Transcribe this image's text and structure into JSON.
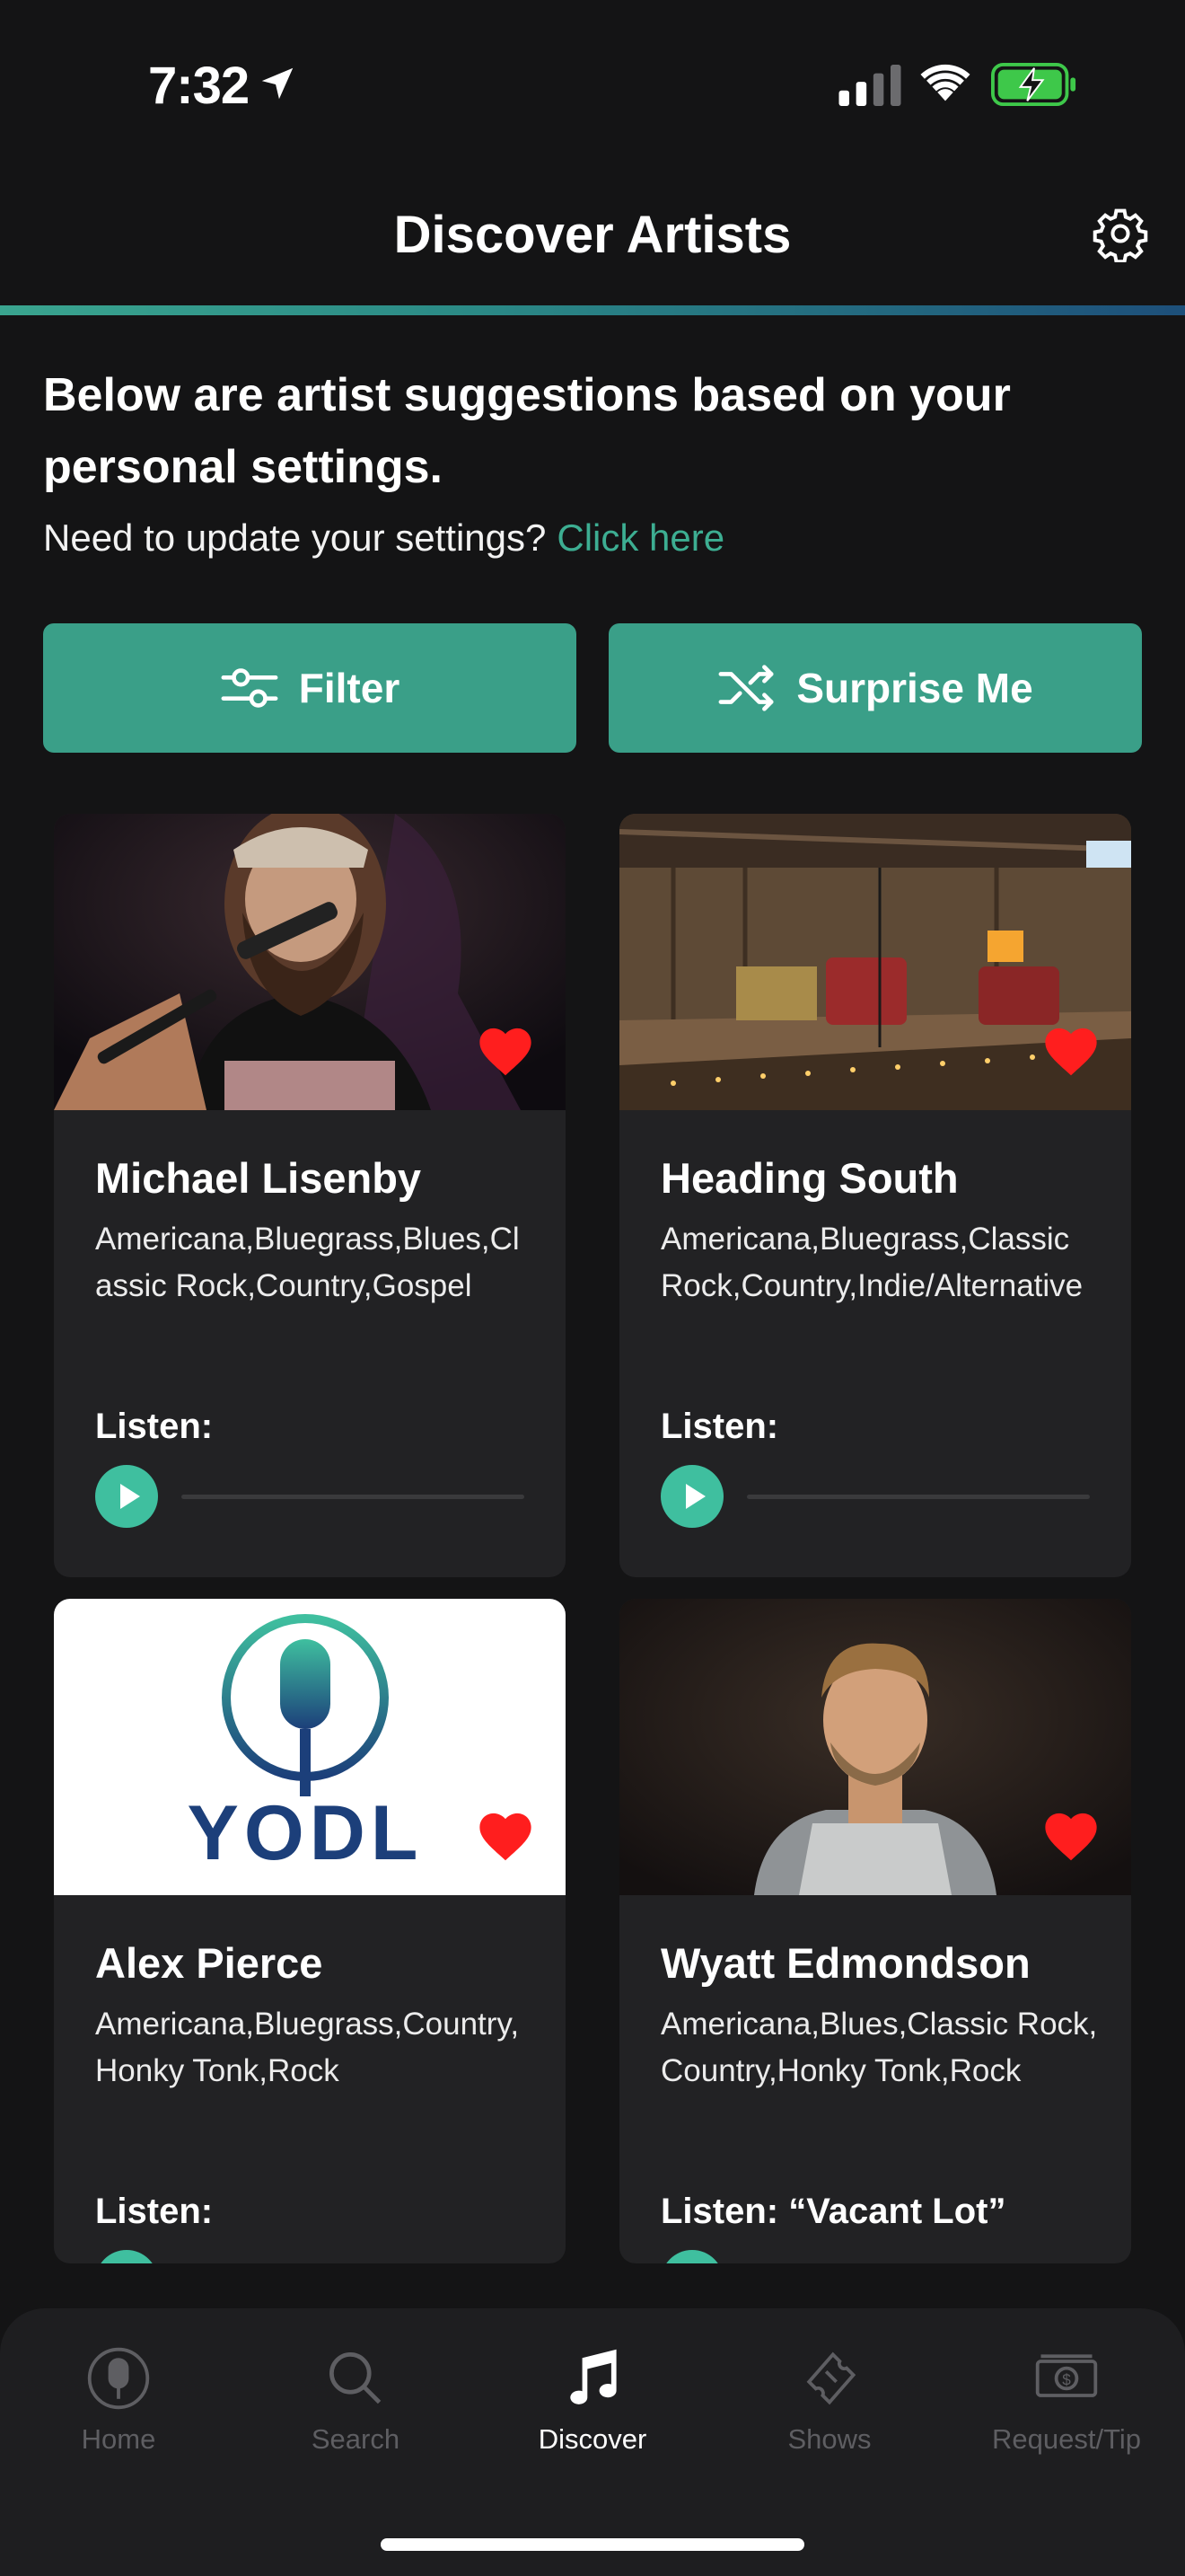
{
  "status_bar": {
    "time": "7:32"
  },
  "header": {
    "title": "Discover Artists"
  },
  "intro": {
    "heading": "Below are artist suggestions based on your personal settings.",
    "prompt": "Need to update your settings?",
    "link": "Click here"
  },
  "actions": {
    "filter_label": "Filter",
    "surprise_label": "Surprise Me"
  },
  "artists": [
    {
      "name": "Michael Lisenby",
      "genres": "Americana,Bluegrass,Blues,Classic Rock,Country,Gospel",
      "listen": "Listen:",
      "favorited": true
    },
    {
      "name": "Heading South",
      "genres": "Americana,Bluegrass,Classic Rock,Country,Indie/Alternative",
      "listen": "Listen:",
      "favorited": true
    },
    {
      "name": "Alex Pierce",
      "genres": "Americana,Bluegrass,Country,Honky Tonk,Rock",
      "listen": "Listen:",
      "favorited": true,
      "logo_text": "YODL"
    },
    {
      "name": "Wyatt Edmondson",
      "genres": "Americana,Blues,Classic Rock,Country,Honky Tonk,Rock",
      "listen": "Listen: “Vacant Lot”",
      "favorited": true
    }
  ],
  "tabs": [
    {
      "label": "Home",
      "icon": "mic-icon",
      "active": false
    },
    {
      "label": "Search",
      "icon": "search-icon",
      "active": false
    },
    {
      "label": "Discover",
      "icon": "music-note-icon",
      "active": true
    },
    {
      "label": "Shows",
      "icon": "ticket-icon",
      "active": false
    },
    {
      "label": "Request/Tip",
      "icon": "money-icon",
      "active": false
    }
  ],
  "colors": {
    "accent": "#3a9f88",
    "heart": "#ff1e1e",
    "background": "#141415",
    "card": "#222224"
  }
}
